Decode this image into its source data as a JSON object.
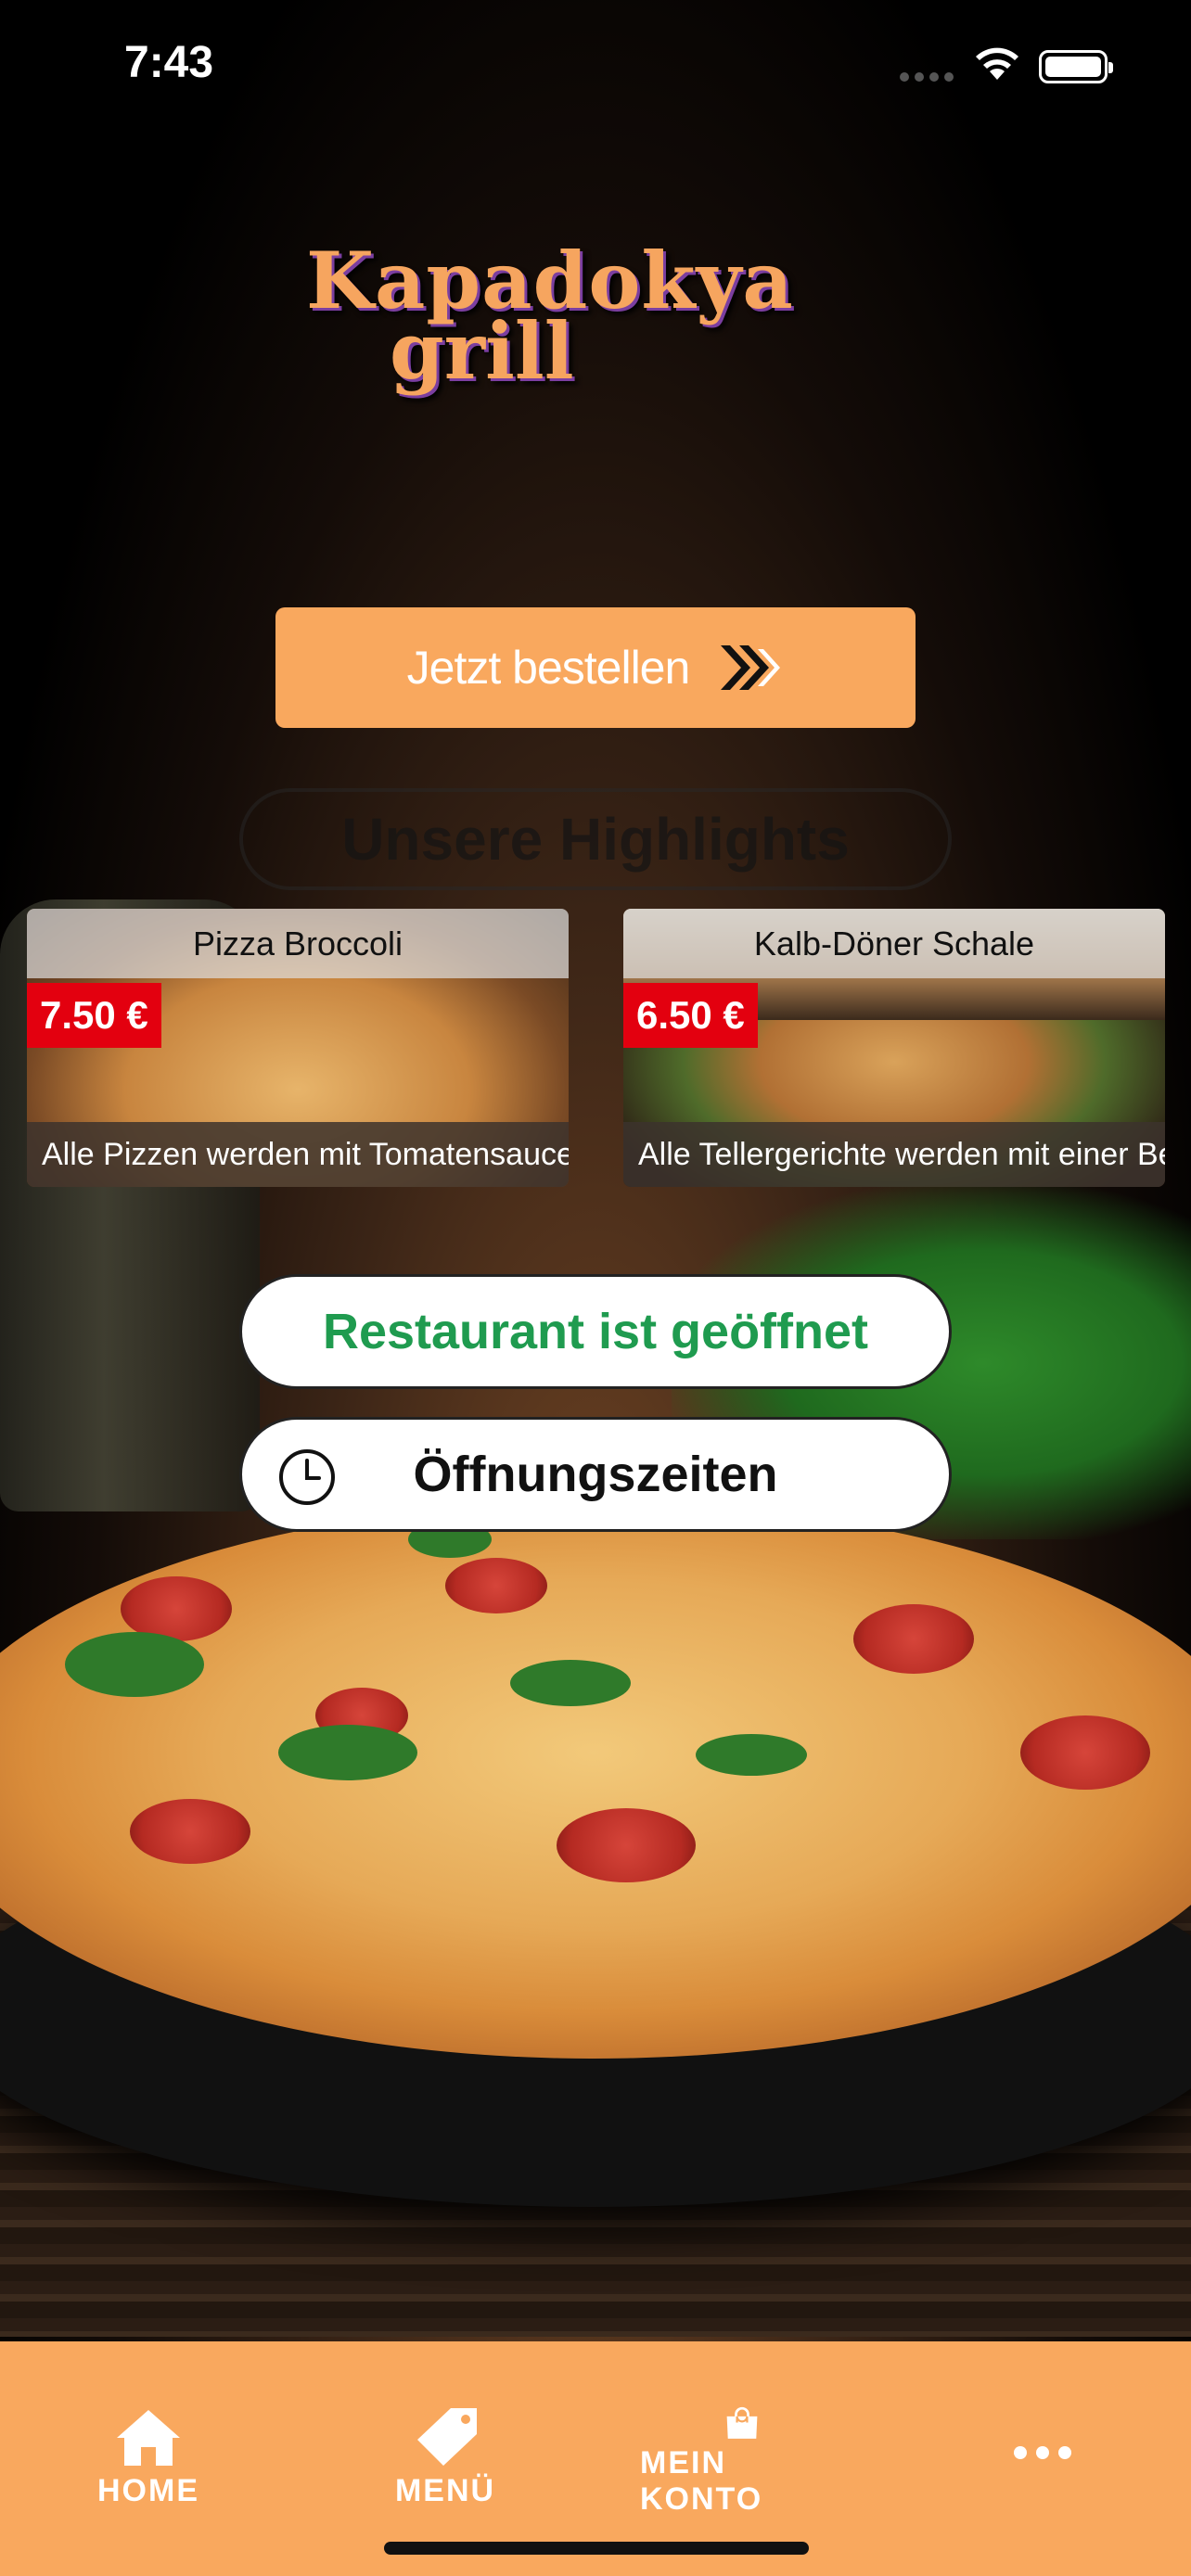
{
  "status_bar": {
    "time": "7:43"
  },
  "logo": {
    "line1": "Kapadokya",
    "line2": "grill"
  },
  "order_button": {
    "label": "Jetzt bestellen"
  },
  "highlights": {
    "title": "Unsere Highlights"
  },
  "cards": [
    {
      "title": "Pizza Broccoli",
      "price": "7.50 €",
      "description": "Alle Pizzen werden mit Tomatensauce un..."
    },
    {
      "title": "Kalb-Döner Schale",
      "price": "6.50 €",
      "description": "Alle Tellergerichte werden mit einer Beila..."
    }
  ],
  "restaurant_status": {
    "label": "Restaurant ist geöffnet",
    "color": "#1f9b4f"
  },
  "opening_hours": {
    "label": "Öffnungszeiten"
  },
  "nav": {
    "items": [
      {
        "label": "HOME",
        "icon": "home-icon"
      },
      {
        "label": "MENÜ",
        "icon": "tag-icon"
      },
      {
        "label": "MEIN KONTO",
        "icon": "shopping-bag-icon"
      },
      {
        "label": "",
        "icon": "more-icon"
      }
    ]
  },
  "colors": {
    "accent": "#f9a85e",
    "price_badge": "#e3000f"
  }
}
